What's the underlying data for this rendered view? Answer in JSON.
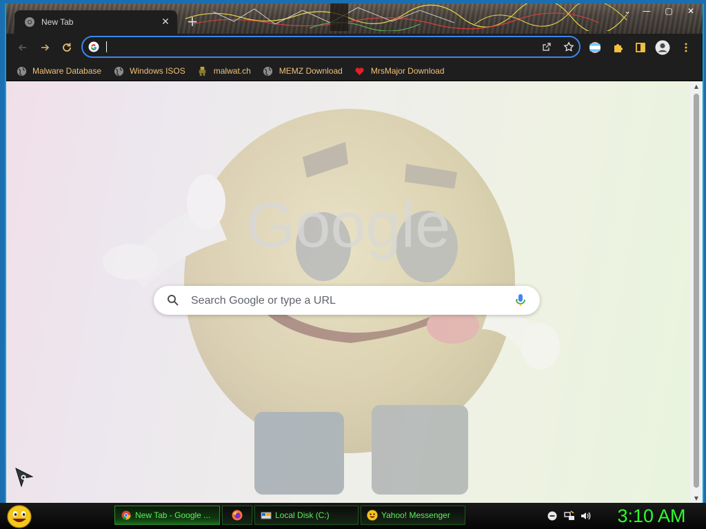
{
  "browser": {
    "tab": {
      "title": "New Tab",
      "icon": "chrome-icon",
      "close": "✕"
    },
    "new_tab": "+",
    "window_controls": {
      "minimize": "—",
      "maximize": "▢",
      "close": "✕",
      "tab_search": "⌄"
    },
    "toolbar": {
      "back_icon": "back-arrow-icon",
      "forward_icon": "forward-arrow-icon",
      "reload_icon": "reload-icon",
      "address_value": "",
      "address_placeholder": ""
    },
    "bookmarks": [
      {
        "label": "Malware Database",
        "icon": "globe-icon"
      },
      {
        "label": "Windows ISOS",
        "icon": "globe-icon"
      },
      {
        "label": "malwat.ch",
        "icon": "figure-icon"
      },
      {
        "label": "MEMZ Download",
        "icon": "globe-icon"
      },
      {
        "label": "MrsMajor Download",
        "icon": "heart-icon"
      }
    ]
  },
  "newtab": {
    "logo_text": "Google",
    "search_placeholder": "Search Google or type a URL"
  },
  "taskbar": {
    "tasks": [
      {
        "label": "New Tab - Google ...",
        "icon": "chrome-icon",
        "active": true
      },
      {
        "label": "",
        "icon": "firefox-icon",
        "active": false
      },
      {
        "label": "Local Disk (C:)",
        "icon": "drive-icon",
        "active": false
      },
      {
        "label": "Yahoo! Messenger",
        "icon": "smiley-icon",
        "active": false
      }
    ],
    "clock": "3:10 AM"
  },
  "colors": {
    "accent": "#3b87f0",
    "bookmark_text": "#f2c27b",
    "taskbar_text": "#5cf05c",
    "clock": "#2bff2b"
  }
}
